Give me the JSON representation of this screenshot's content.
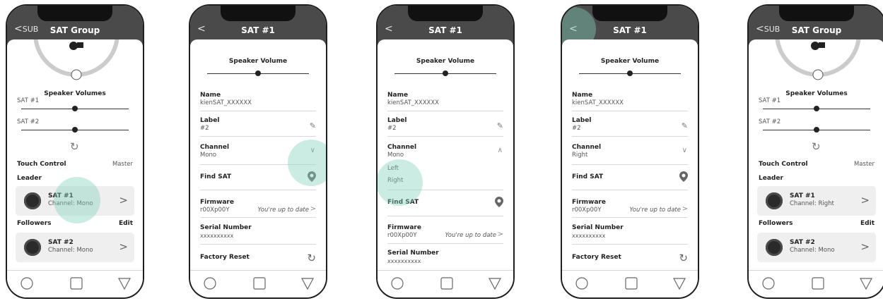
{
  "colors": {
    "header": "#4a4a4a",
    "touch": "#84d2bc",
    "card": "#efefef"
  },
  "screens": [
    {
      "back": "SUB",
      "title": "SAT Group",
      "volumes_label": "Speaker Volumes",
      "sat1": "SAT #1",
      "sat2": "SAT #2",
      "touch_control": "Touch Control",
      "master": "Master",
      "leader": "Leader",
      "leader_card": {
        "name": "SAT #1",
        "channel": "Channel: Mono"
      },
      "followers": "Followers",
      "edit": "Edit",
      "follower_card": {
        "name": "SAT #2",
        "channel": "Channel: Mono"
      }
    },
    {
      "title": "SAT #1",
      "volume_label": "Speaker Volume",
      "name_label": "Name",
      "name_value": "kienSAT_XXXXXX",
      "label_label": "Label",
      "label_value": "#2",
      "channel_label": "Channel",
      "channel_value": "Mono",
      "find_sat": "Find SAT",
      "firmware_label": "Firmware",
      "firmware_value": "r00Xp00Y",
      "firmware_status": "You're up to date",
      "serial_label": "Serial Number",
      "serial_value": "xxxxxxxxxx",
      "factory_reset": "Factory Reset"
    },
    {
      "title": "SAT #1",
      "volume_label": "Speaker Volume",
      "name_label": "Name",
      "name_value": "kienSAT_XXXXXX",
      "label_label": "Label",
      "label_value": "#2",
      "channel_label": "Channel",
      "channel_value": "Mono",
      "option_left": "Left",
      "option_right": "Right",
      "find_sat": "Find SAT",
      "firmware_label": "Firmware",
      "firmware_value": "r00Xp00Y",
      "firmware_status": "You're up to date",
      "serial_label": "Serial Number",
      "serial_value": "xxxxxxxxxx"
    },
    {
      "title": "SAT #1",
      "volume_label": "Speaker Volume",
      "name_label": "Name",
      "name_value": "kienSAT_XXXXXX",
      "label_label": "Label",
      "label_value": "#2",
      "channel_label": "Channel",
      "channel_value": "Right",
      "find_sat": "Find SAT",
      "firmware_label": "Firmware",
      "firmware_value": "r00Xp00Y",
      "firmware_status": "You're up to date",
      "serial_label": "Serial Number",
      "serial_value": "xxxxxxxxxx",
      "factory_reset": "Factory Reset"
    },
    {
      "back": "SUB",
      "title": "SAT Group",
      "volumes_label": "Speaker Volumes",
      "sat1": "SAT #1",
      "sat2": "SAT #2",
      "touch_control": "Touch Control",
      "master": "Master",
      "leader": "Leader",
      "leader_card": {
        "name": "SAT #1",
        "channel": "Channel: Right"
      },
      "followers": "Followers",
      "edit": "Edit",
      "follower_card": {
        "name": "SAT #2",
        "channel": "Channel: Mono"
      }
    }
  ],
  "nav_icons": [
    "home-circle-icon",
    "square-icon",
    "triangle-icon"
  ]
}
